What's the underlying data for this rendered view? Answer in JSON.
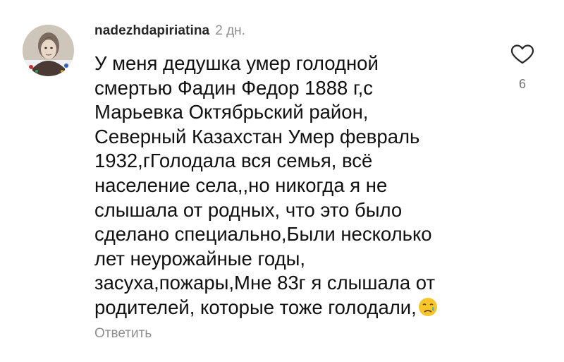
{
  "comment": {
    "username": "nadezhdapiriatina",
    "timestamp": "2 дн.",
    "lines": [
      "У меня дедушка умер голодной",
      "смертью Фадин  Федор 1888 г,с",
      "Марьевка Октябрьский район,",
      "Северный Казахстан Умер февраль",
      "1932,гГолодала вся семья, всё",
      "население села,,но никогда я не",
      "слышала от родных, что это было",
      "сделано специально,Были несколько",
      "лет неурожайные годы,",
      "засуха,пожары,Мне 83г я слышала от",
      "родителей, которые тоже голодали,"
    ],
    "emoji": "crying-face-emoji",
    "reply_label": "Ответить",
    "like_count": "6",
    "like_icon": "heart-outline-icon"
  },
  "colors": {
    "text": "#111111",
    "username": "#262626",
    "secondary": "#8e8e8e",
    "icon": "#262626"
  }
}
